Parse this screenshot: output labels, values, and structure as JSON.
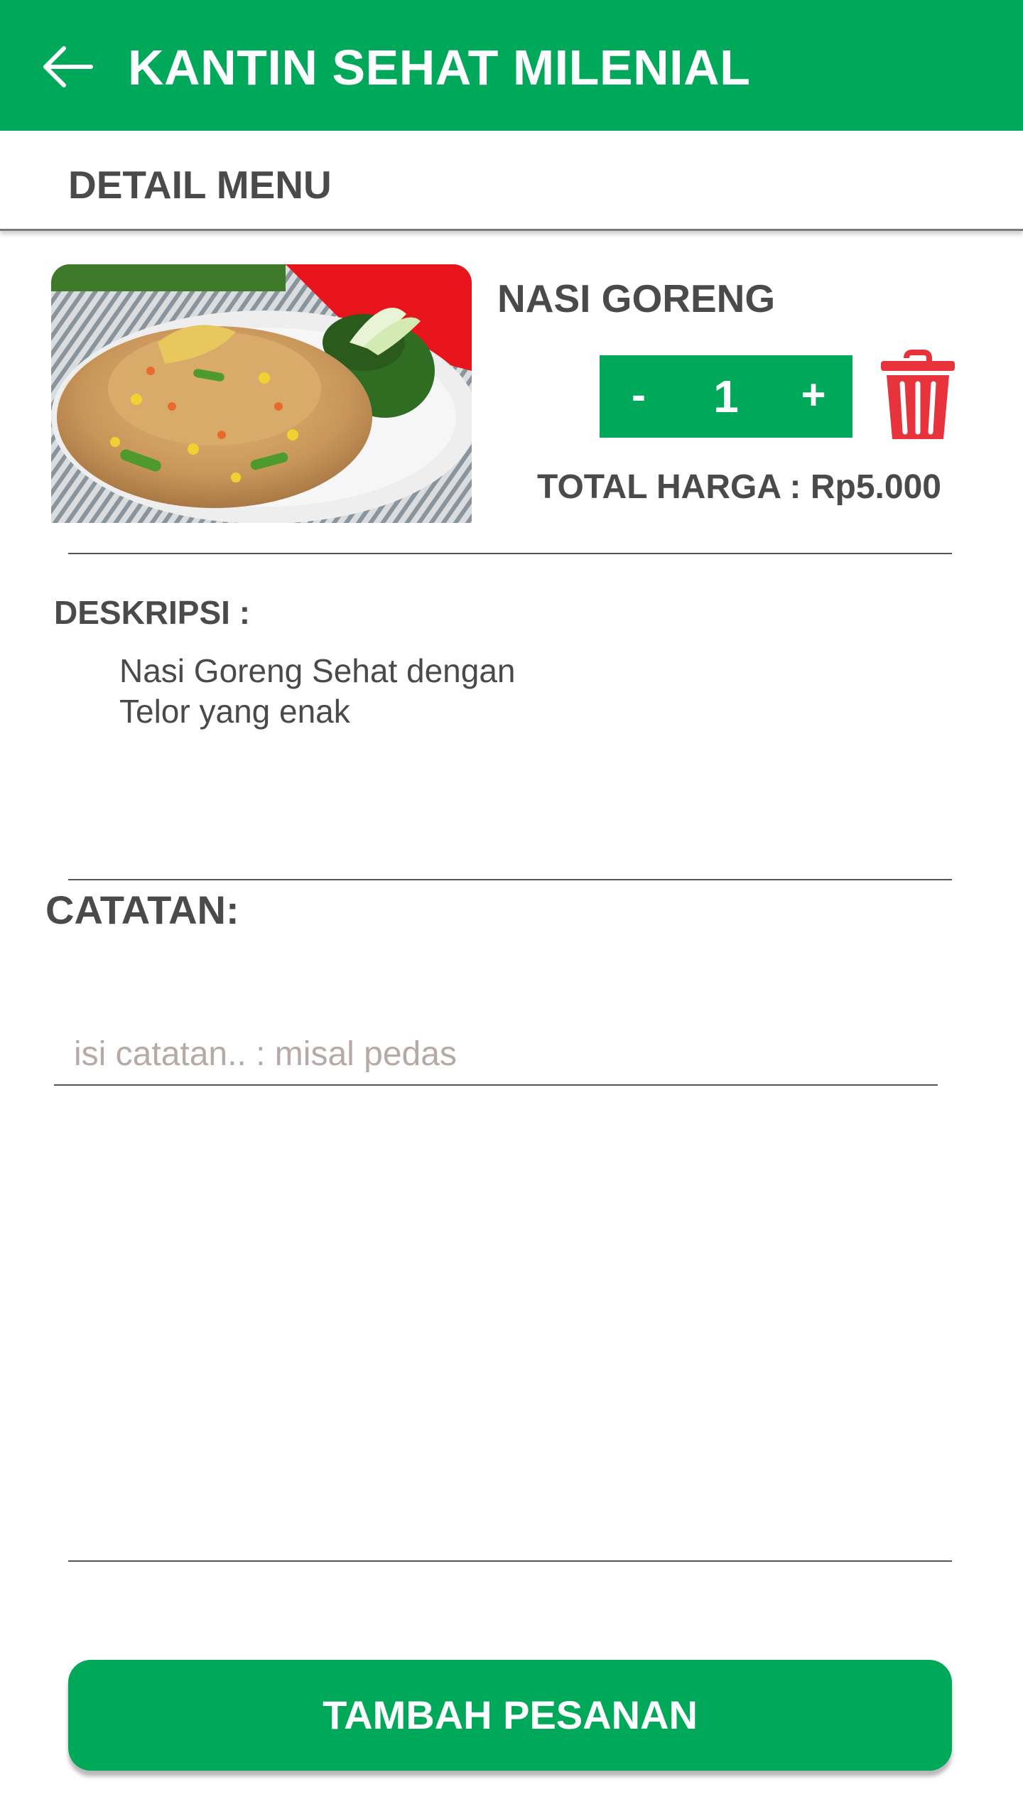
{
  "app_bar": {
    "title": "KANTIN SEHAT MILENIAL",
    "back_icon": "arrow-left-icon",
    "background_color": "#00a85a"
  },
  "sub_header": {
    "title": "DETAIL MENU"
  },
  "item": {
    "image_icon": "nasi-goreng-photo",
    "name": "NASI GORENG",
    "quantity": "1",
    "minus_label": "-",
    "plus_label": "+",
    "delete_icon": "trash-icon",
    "delete_color": "#e8323c",
    "total_text": "TOTAL HARGA : Rp5.000"
  },
  "description": {
    "label": "DESKRIPSI :",
    "line1": "Nasi Goreng Sehat dengan",
    "line2": "Telor yang enak"
  },
  "notes": {
    "label": "CATATAN:",
    "placeholder": "isi catatan.. : misal pedas",
    "value": ""
  },
  "action": {
    "submit_label": "TAMBAH PESANAN"
  }
}
